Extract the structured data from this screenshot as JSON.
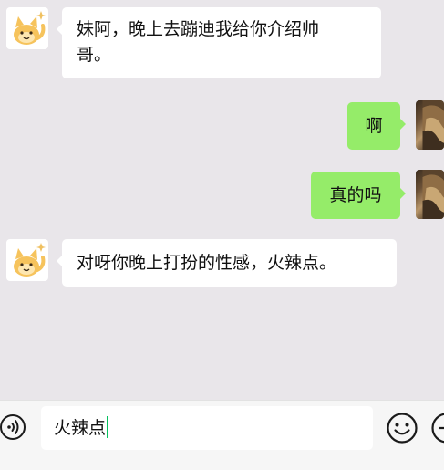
{
  "messages": [
    {
      "side": "left",
      "text": "妹阿，晚上去蹦迪我给你介绍帅哥。",
      "line1": "妹阿，晚上去蹦迪我给你介绍帅",
      "line2": "哥。"
    },
    {
      "side": "right",
      "text": "啊"
    },
    {
      "side": "right",
      "text": "真的吗"
    },
    {
      "side": "left",
      "text": "对呀你晚上打扮的性感，火辣点。"
    }
  ],
  "composer": {
    "input_value": "火辣点",
    "voice_icon": "voice-icon",
    "emoji_icon": "emoji-icon",
    "plus_icon": "plus-icon"
  },
  "colors": {
    "background": "#e9e6ea",
    "outgoing_bubble": "#95ec69",
    "incoming_bubble": "#ffffff",
    "caret": "#07c160"
  }
}
